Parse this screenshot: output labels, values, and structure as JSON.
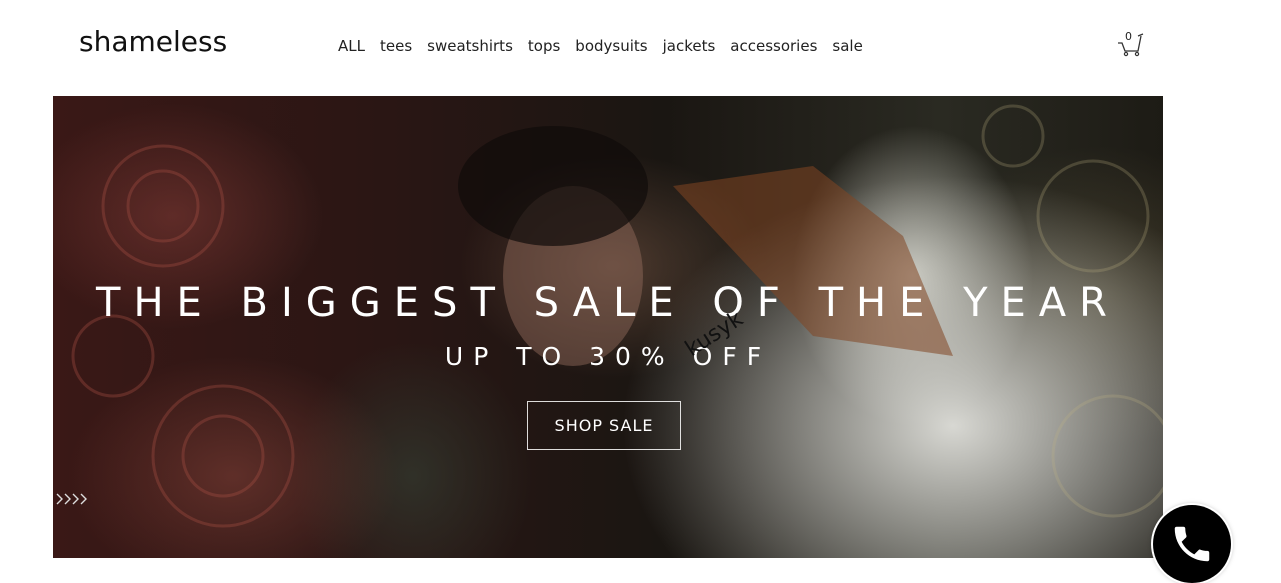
{
  "brand": {
    "logo_text": "shameless"
  },
  "nav": {
    "items": [
      {
        "label": "ALL"
      },
      {
        "label": "tees"
      },
      {
        "label": "sweatshirts"
      },
      {
        "label": "tops"
      },
      {
        "label": "bodysuits"
      },
      {
        "label": "jackets"
      },
      {
        "label": "accessories"
      },
      {
        "label": "sale"
      }
    ]
  },
  "cart": {
    "count": "0",
    "icon": "cart-icon"
  },
  "hero": {
    "title": "THE BIGGEST SALE OF THE YEAR",
    "subtitle": "UP TO 30% OFF",
    "watermark": "kusyk",
    "button_label": "SHOP SALE",
    "slider_arrow_icon": "chevron-icon"
  },
  "call": {
    "icon": "phone-icon"
  },
  "colors": {
    "text": "#111111",
    "hero_text": "#ffffff",
    "call_button": "#000000"
  }
}
